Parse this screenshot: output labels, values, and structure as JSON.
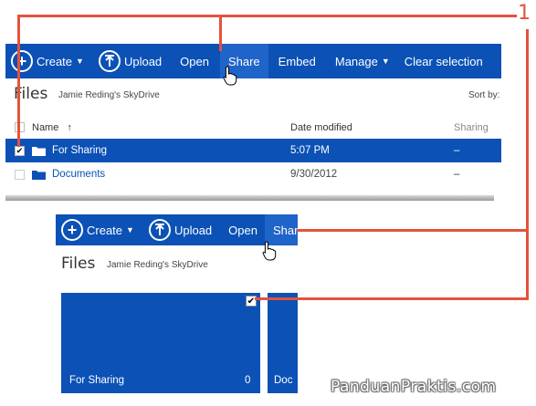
{
  "callout_number": "1",
  "colors": {
    "accent": "#0b51b6",
    "callout": "#e4523b"
  },
  "top": {
    "commands": {
      "create": "Create",
      "upload": "Upload",
      "open": "Open",
      "share": "Share",
      "embed": "Embed",
      "manage": "Manage",
      "clear": "Clear selection"
    },
    "title": "Files",
    "owner": "Jamie Reding's SkyDrive",
    "sort_label": "Sort by:",
    "columns": {
      "name": "Name",
      "sort_arrow": "↑",
      "date": "Date modified",
      "sharing": "Sharing"
    },
    "rows": [
      {
        "name": "For Sharing",
        "date": "5:07 PM",
        "sharing": "–",
        "selected": true
      },
      {
        "name": "Documents",
        "date": "9/30/2012",
        "sharing": "–",
        "selected": false
      }
    ]
  },
  "bottom": {
    "commands": {
      "create": "Create",
      "upload": "Upload",
      "open": "Open",
      "share": "Share"
    },
    "title": "Files",
    "owner": "Jamie Reding's SkyDrive",
    "tiles": [
      {
        "name": "For Sharing",
        "count": "0",
        "checked": true
      },
      {
        "name": "Doc"
      }
    ]
  },
  "watermark": "PanduanPraktis.com"
}
